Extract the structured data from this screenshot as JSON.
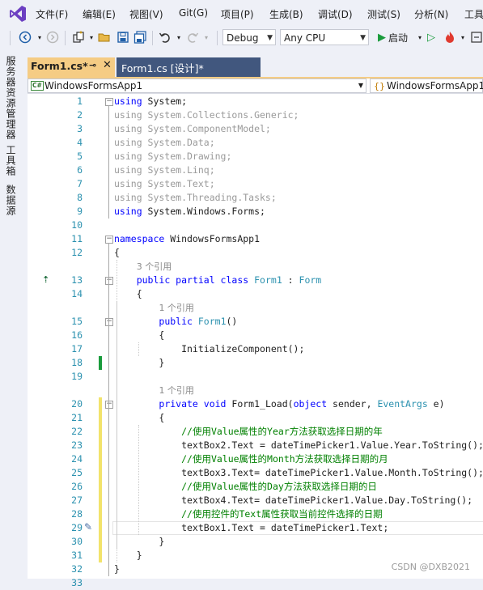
{
  "menu": [
    "文件(F)",
    "编辑(E)",
    "视图(V)",
    "Git(G)",
    "项目(P)",
    "生成(B)",
    "调试(D)",
    "测试(S)",
    "分析(N)",
    "工具"
  ],
  "toolbar": {
    "config": "Debug",
    "platform": "Any CPU",
    "start_label": "启动"
  },
  "side_tabs": [
    "服务器资源管理器",
    "工具箱",
    "数据源"
  ],
  "tabs": {
    "active": "Form1.cs*",
    "inactive": "Form1.cs [设计]*"
  },
  "navbar": {
    "project": "WindowsFormsApp1",
    "class": "WindowsFormsApp1"
  },
  "code_lines": [
    {
      "n": "1",
      "segs": [
        [
          "kw",
          "using"
        ],
        [
          "",
          " System;"
        ]
      ]
    },
    {
      "n": "2",
      "segs": [
        [
          "gr",
          "using System.Collections.Generic;"
        ]
      ]
    },
    {
      "n": "3",
      "segs": [
        [
          "gr",
          "using System.ComponentModel;"
        ]
      ]
    },
    {
      "n": "4",
      "segs": [
        [
          "gr",
          "using System.Data;"
        ]
      ]
    },
    {
      "n": "5",
      "segs": [
        [
          "gr",
          "using System.Drawing;"
        ]
      ]
    },
    {
      "n": "6",
      "segs": [
        [
          "gr",
          "using System.Linq;"
        ]
      ]
    },
    {
      "n": "7",
      "segs": [
        [
          "gr",
          "using System.Text;"
        ]
      ]
    },
    {
      "n": "8",
      "segs": [
        [
          "gr",
          "using System.Threading.Tasks;"
        ]
      ]
    },
    {
      "n": "9",
      "segs": [
        [
          "kw",
          "using"
        ],
        [
          "",
          " System.Windows.Forms;"
        ]
      ]
    },
    {
      "n": "10",
      "segs": []
    },
    {
      "n": "11",
      "segs": [
        [
          "kw",
          "namespace"
        ],
        [
          "",
          " WindowsFormsApp1"
        ]
      ]
    },
    {
      "n": "12",
      "segs": [
        [
          "",
          "{"
        ]
      ]
    },
    {
      "hint": "3 个引用",
      "indent": 4
    },
    {
      "n": "13",
      "segs": [
        [
          "",
          "    "
        ],
        [
          "kw",
          "public partial class"
        ],
        [
          "",
          " "
        ],
        [
          "ty",
          "Form1"
        ],
        [
          "",
          " : "
        ],
        [
          "ty",
          "Form"
        ]
      ]
    },
    {
      "n": "14",
      "segs": [
        [
          "",
          "    {"
        ]
      ]
    },
    {
      "hint": "1 个引用",
      "indent": 8
    },
    {
      "n": "15",
      "segs": [
        [
          "",
          "        "
        ],
        [
          "kw",
          "public"
        ],
        [
          "",
          " "
        ],
        [
          "ty",
          "Form1"
        ],
        [
          "",
          "()"
        ]
      ]
    },
    {
      "n": "16",
      "segs": [
        [
          "",
          "        {"
        ]
      ]
    },
    {
      "n": "17",
      "segs": [
        [
          "",
          "            InitializeComponent();"
        ]
      ]
    },
    {
      "n": "18",
      "segs": [
        [
          "",
          "        }"
        ]
      ]
    },
    {
      "n": "19",
      "segs": []
    },
    {
      "hint": "1 个引用",
      "indent": 8
    },
    {
      "n": "20",
      "segs": [
        [
          "",
          "        "
        ],
        [
          "kw",
          "private void"
        ],
        [
          "",
          " Form1_Load("
        ],
        [
          "kw",
          "object"
        ],
        [
          "",
          " sender, "
        ],
        [
          "ty",
          "EventArgs"
        ],
        [
          "",
          " e)"
        ]
      ]
    },
    {
      "n": "21",
      "segs": [
        [
          "",
          "        {"
        ]
      ]
    },
    {
      "n": "22",
      "segs": [
        [
          "",
          "            "
        ],
        [
          "cm",
          "//使用Value属性的Year方法获取选择日期的年"
        ]
      ]
    },
    {
      "n": "23",
      "segs": [
        [
          "",
          "            textBox2.Text = dateTimePicker1.Value.Year.ToString();"
        ]
      ]
    },
    {
      "n": "24",
      "segs": [
        [
          "",
          "            "
        ],
        [
          "cm",
          "//使用Value属性的Month方法获取选择日期的月"
        ]
      ]
    },
    {
      "n": "25",
      "segs": [
        [
          "",
          "            textBox3.Text= dateTimePicker1.Value.Month.ToString();"
        ]
      ]
    },
    {
      "n": "26",
      "segs": [
        [
          "",
          "            "
        ],
        [
          "cm",
          "//使用Value属性的Day方法获取选择日期的日"
        ]
      ]
    },
    {
      "n": "27",
      "segs": [
        [
          "",
          "            textBox4.Text= dateTimePicker1.Value.Day.ToString();"
        ]
      ]
    },
    {
      "n": "28",
      "segs": [
        [
          "",
          "            "
        ],
        [
          "cm",
          "//使用控件的Text属性获取当前控件选择的日期"
        ]
      ]
    },
    {
      "n": "29",
      "segs": [
        [
          "",
          "            textBox1.Text = dateTimePicker1.Text;"
        ]
      ]
    },
    {
      "n": "30",
      "segs": [
        [
          "",
          "        }"
        ]
      ]
    },
    {
      "n": "31",
      "segs": [
        [
          "",
          "    }"
        ]
      ]
    },
    {
      "n": "32",
      "segs": [
        [
          "",
          "}"
        ]
      ]
    },
    {
      "n": "33",
      "segs": []
    }
  ],
  "watermark": "CSDN @DXB2021"
}
